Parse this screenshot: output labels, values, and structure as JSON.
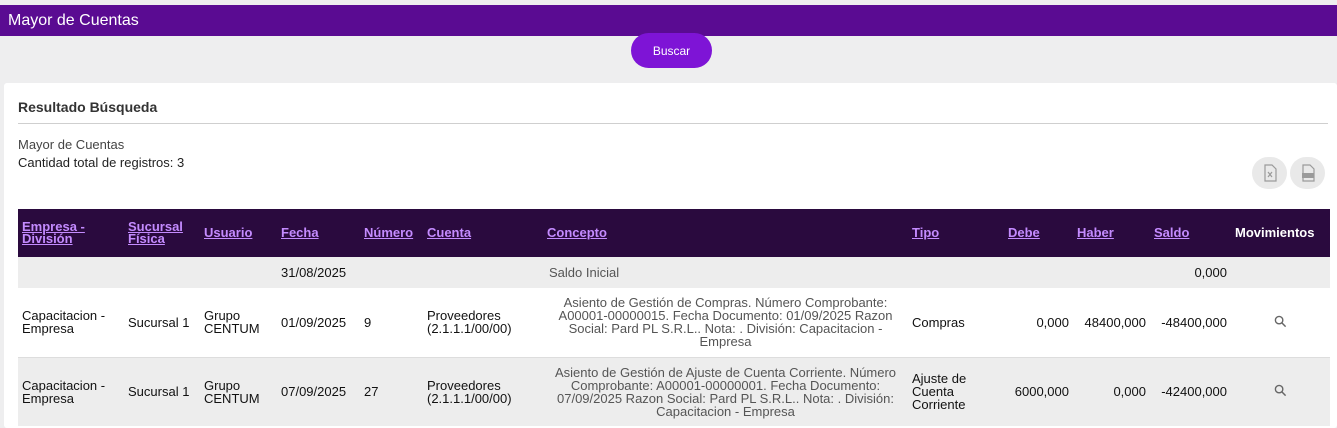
{
  "header": {
    "title": "Mayor de Cuentas"
  },
  "search": {
    "label": "Buscar"
  },
  "results": {
    "title": "Resultado Búsqueda",
    "subtitle": "Mayor de Cuentas",
    "count_text": "Cantidad total de registros: 3",
    "export_buttons": [
      "excel-icon",
      "csv-icon"
    ]
  },
  "table": {
    "headers": [
      "Empresa - División",
      "Sucursal Física",
      "Usuario",
      "Fecha",
      "Número",
      "Cuenta",
      "Concepto",
      "Tipo",
      "Debe",
      "Haber",
      "Saldo",
      "Movimientos"
    ],
    "saldo_inicial": {
      "fecha": "31/08/2025",
      "concepto": "Saldo Inicial",
      "saldo": "0,000"
    },
    "rows": [
      {
        "empresa": "Capacitacion - Empresa",
        "sucursal": "Sucursal 1",
        "usuario": "Grupo CENTUM",
        "fecha": "01/09/2025",
        "numero": "9",
        "cuenta": "Proveedores (2.1.1.1/00/00)",
        "concepto": "Asiento de Gestión de Compras. Número Comprobante: A00001-00000015. Fecha Documento: 01/09/2025 Razon Social: Pard PL S.R.L.. Nota: . División: Capacitacion - Empresa",
        "tipo": "Compras",
        "debe": "0,000",
        "haber": "48400,000",
        "saldo": "-48400,000"
      },
      {
        "empresa": "Capacitacion - Empresa",
        "sucursal": "Sucursal 1",
        "usuario": "Grupo CENTUM",
        "fecha": "07/09/2025",
        "numero": "27",
        "cuenta": "Proveedores (2.1.1.1/00/00)",
        "concepto": "Asiento de Gestión de Ajuste de Cuenta Corriente. Número Comprobante: A00001-00000001. Fecha Documento: 07/09/2025 Razon Social: Pard PL S.R.L.. Nota: . División: Capacitacion - Empresa",
        "tipo": "Ajuste de Cuenta Corriente",
        "debe": "6000,000",
        "haber": "0,000",
        "saldo": "-42400,000"
      }
    ]
  },
  "colors": {
    "titlebar": "#5a0b92",
    "button": "#7e14d6",
    "table_header": "#2a0a3e",
    "header_link": "#c48bff"
  }
}
